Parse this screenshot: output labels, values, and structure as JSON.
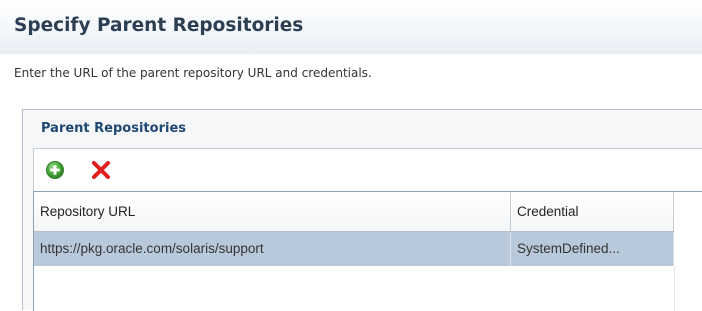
{
  "page": {
    "title": "Specify Parent Repositories",
    "instructions": "Enter the URL of the parent repository URL and credentials."
  },
  "panel": {
    "title": "Parent Repositories",
    "toolbar": [
      {
        "icon": "add-icon",
        "color": "#3f9c35"
      },
      {
        "icon": "delete-icon",
        "color": "#e11d1d"
      }
    ]
  },
  "table": {
    "columns": [
      "Repository URL",
      "Credential"
    ],
    "rows": [
      {
        "url": "https://pkg.oracle.com/solaris/support",
        "credential": "SystemDefined...",
        "selected": true
      }
    ],
    "selected_row_color": "#b9c9dc"
  }
}
